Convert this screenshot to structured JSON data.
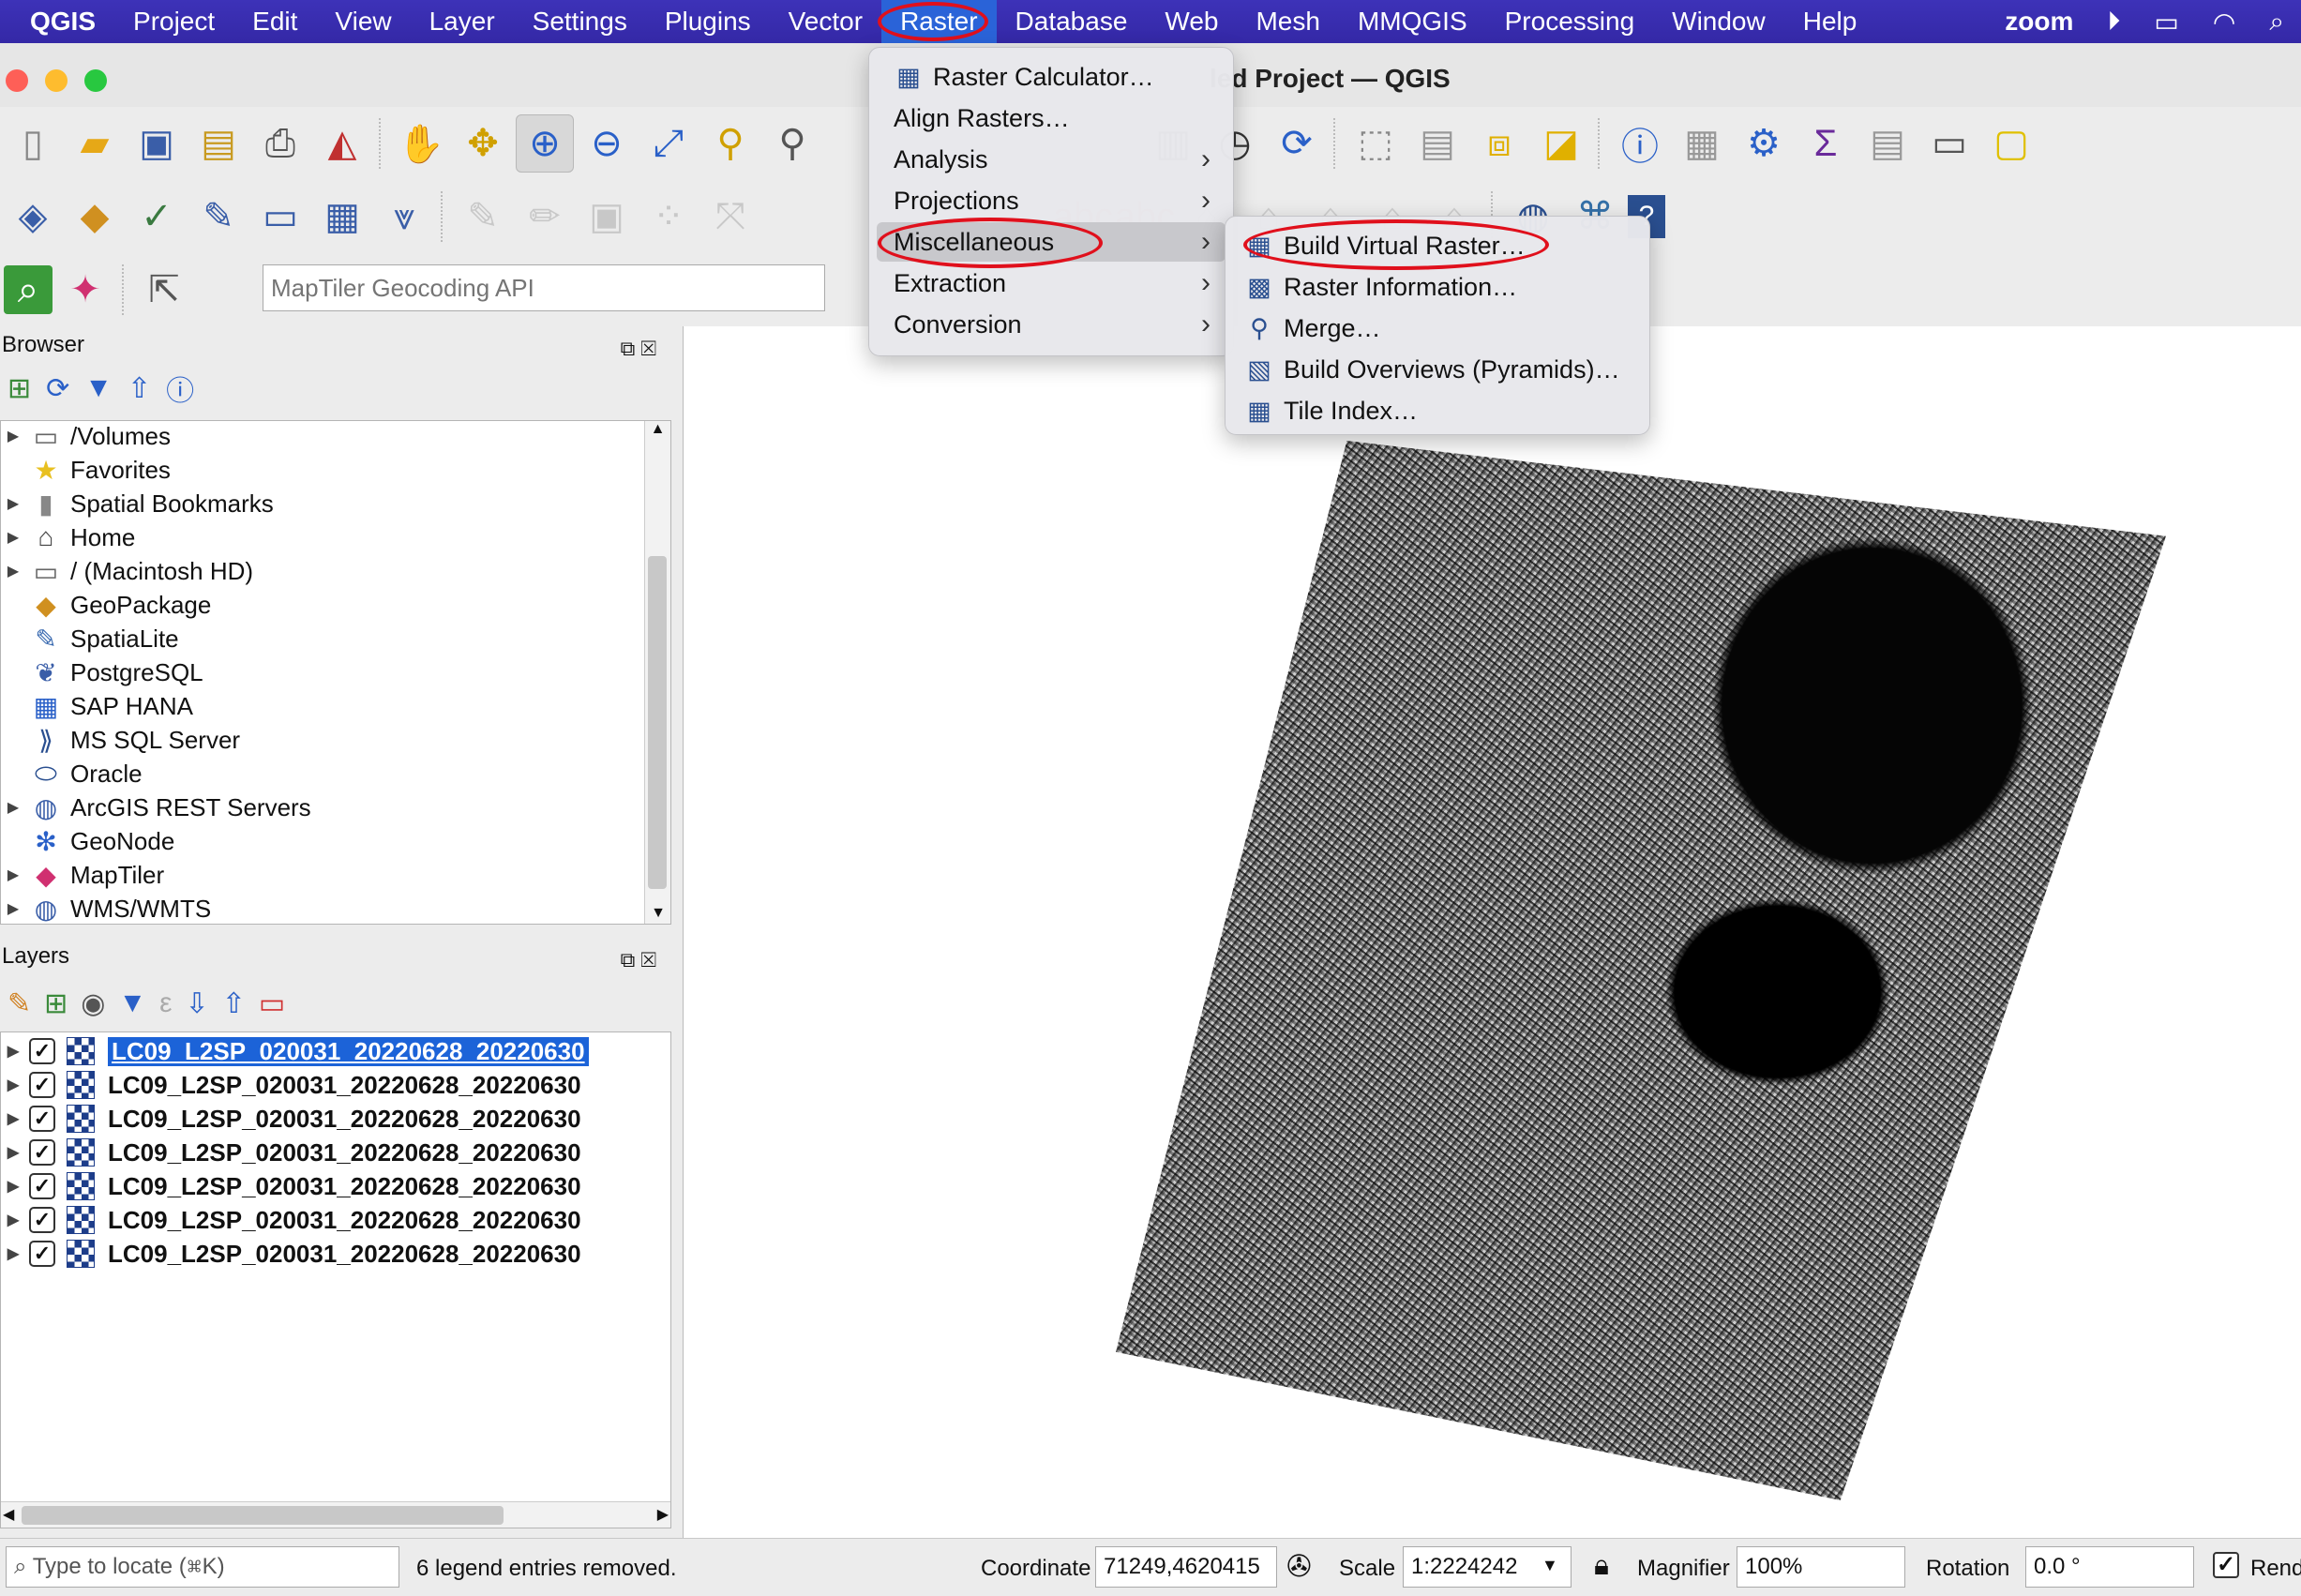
{
  "menubar": {
    "app": "QGIS",
    "items": [
      "Project",
      "Edit",
      "View",
      "Layer",
      "Settings",
      "Plugins",
      "Vector",
      "Raster",
      "Database",
      "Web",
      "Mesh",
      "MMQGIS",
      "Processing",
      "Window",
      "Help"
    ],
    "right": {
      "zoom": "zoom",
      "play_icon": "play-circle-icon",
      "battery_icon": "battery-icon",
      "wifi_icon": "wifi-icon",
      "search_icon": "search-icon"
    }
  },
  "window": {
    "title": "led Project — QGIS"
  },
  "search": {
    "placeholder": "MapTiler Geocoding API"
  },
  "browser": {
    "title": "Browser",
    "items": [
      {
        "label": "/Volumes",
        "expand": true,
        "icon": "folder-icon"
      },
      {
        "label": "Favorites",
        "expand": false,
        "icon": "star-icon"
      },
      {
        "label": "Spatial Bookmarks",
        "expand": true,
        "icon": "bookmark-icon"
      },
      {
        "label": "Home",
        "expand": true,
        "icon": "home-icon"
      },
      {
        "label": "/ (Macintosh HD)",
        "expand": true,
        "icon": "folder-icon"
      },
      {
        "label": "GeoPackage",
        "expand": false,
        "icon": "geopackage-icon"
      },
      {
        "label": "SpatiaLite",
        "expand": false,
        "icon": "feather-icon"
      },
      {
        "label": "PostgreSQL",
        "expand": false,
        "icon": "elephant-icon"
      },
      {
        "label": "SAP HANA",
        "expand": false,
        "icon": "sap-icon"
      },
      {
        "label": "MS SQL Server",
        "expand": false,
        "icon": "mssql-icon"
      },
      {
        "label": "Oracle",
        "expand": false,
        "icon": "oracle-icon"
      },
      {
        "label": "ArcGIS REST Servers",
        "expand": true,
        "icon": "globe-icon"
      },
      {
        "label": "GeoNode",
        "expand": false,
        "icon": "geonode-icon"
      },
      {
        "label": "MapTiler",
        "expand": true,
        "icon": "maptiler-icon"
      },
      {
        "label": "WMS/WMTS",
        "expand": true,
        "icon": "globe-icon"
      }
    ]
  },
  "layers": {
    "title": "Layers",
    "items": [
      "LC09_L2SP_020031_20220628_20220630",
      "LC09_L2SP_020031_20220628_20220630",
      "LC09_L2SP_020031_20220628_20220630",
      "LC09_L2SP_020031_20220628_20220630",
      "LC09_L2SP_020031_20220628_20220630",
      "LC09_L2SP_020031_20220628_20220630",
      "LC09_L2SP_020031_20220628_20220630"
    ],
    "selected_index": 0
  },
  "raster_menu": {
    "items": [
      {
        "label": "Raster Calculator…",
        "submenu": false,
        "icon": "calculator-icon"
      },
      {
        "label": "Align Rasters…",
        "submenu": false
      },
      {
        "label": "Analysis",
        "submenu": true
      },
      {
        "label": "Projections",
        "submenu": true
      },
      {
        "label": "Miscellaneous",
        "submenu": true,
        "highlight": true
      },
      {
        "label": "Extraction",
        "submenu": true
      },
      {
        "label": "Conversion",
        "submenu": true
      }
    ]
  },
  "misc_menu": {
    "items": [
      {
        "label": "Build Virtual Raster…",
        "icon": "virtual-raster-icon"
      },
      {
        "label": "Raster Information…",
        "icon": "raster-info-icon"
      },
      {
        "label": "Merge…",
        "icon": "merge-icon"
      },
      {
        "label": "Build Overviews (Pyramids)…",
        "icon": "pyramids-icon"
      },
      {
        "label": "Tile Index…",
        "icon": "tile-index-icon"
      }
    ]
  },
  "statusbar": {
    "locate_placeholder": "Type to locate (⌘K)",
    "message": "6 legend entries removed.",
    "coordinate_label": "Coordinate",
    "coordinate_value": "71249,4620415",
    "scale_label": "Scale",
    "scale_value": "1:2224242",
    "magnifier_label": "Magnifier",
    "magnifier_value": "100%",
    "rotation_label": "Rotation",
    "rotation_value": "0.0 °",
    "render_label": "Rend"
  },
  "colors": {
    "menubar": "#3428a6",
    "selection": "#1c63d8",
    "annotation": "#e0101c"
  }
}
